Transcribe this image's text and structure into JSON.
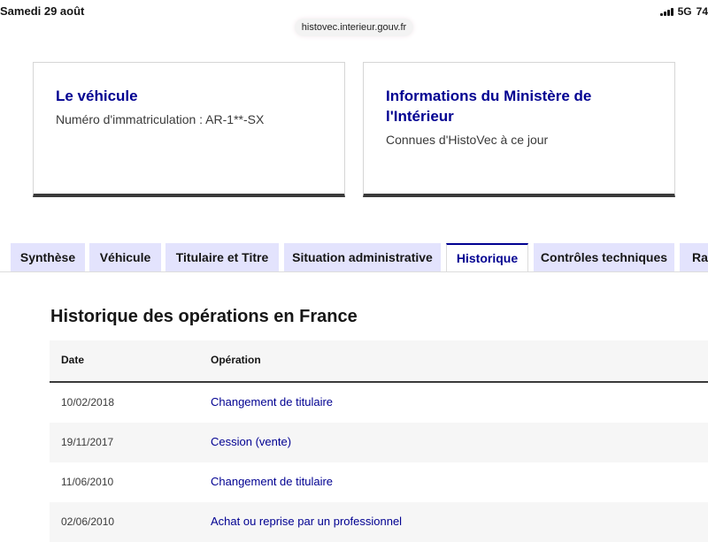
{
  "status_bar": {
    "date": "Samedi 29 août",
    "network": "5G",
    "battery": "74"
  },
  "browser": {
    "url": "histovec.interieur.gouv.fr"
  },
  "cards": [
    {
      "title": "Le véhicule",
      "text": "Numéro d'immatriculation : AR-1**-SX"
    },
    {
      "title": "Informations du Ministère de l'Intérieur",
      "text": "Connues d'HistoVec à ce jour"
    }
  ],
  "tabs": [
    {
      "label": "Synthèse",
      "active": false
    },
    {
      "label": "Véhicule",
      "active": false
    },
    {
      "label": "Titulaire et Titre",
      "active": false
    },
    {
      "label": "Situation administrative",
      "active": false
    },
    {
      "label": "Historique",
      "active": true
    },
    {
      "label": "Contrôles techniques",
      "active": false
    },
    {
      "label": "Rap",
      "active": false
    }
  ],
  "section": {
    "title": "Historique des opérations en France"
  },
  "table": {
    "headers": [
      "Date",
      "Opération"
    ],
    "rows": [
      {
        "date": "10/02/2018",
        "operation": "Changement de titulaire"
      },
      {
        "date": "19/11/2017",
        "operation": "Cession (vente)"
      },
      {
        "date": "11/06/2010",
        "operation": "Changement de titulaire"
      },
      {
        "date": "02/06/2010",
        "operation": "Achat ou reprise par un professionnel"
      }
    ]
  },
  "colors": {
    "primary": "#000091",
    "tab_bg": "#e3e3fd",
    "row_alt": "#f6f6f6"
  }
}
